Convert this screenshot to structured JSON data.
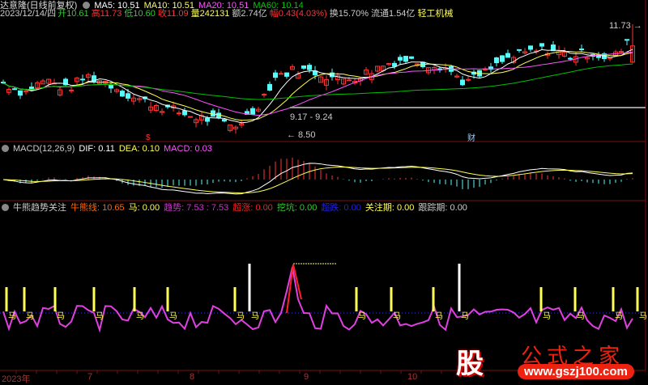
{
  "header": {
    "stock_name": "达意隆(日线前复权)",
    "ma5": "MA5: 10.51",
    "ma10": "MA10: 10.51",
    "ma20": "MA20: 10.51",
    "ma60": "MA60: 10.14",
    "date": "2023/12/14/四",
    "open": "开10.61",
    "high": "高11.73",
    "low": "低10.60",
    "close": "收11.09",
    "volume": "量242131",
    "amount": "额2.74亿",
    "change": "幅0.43(4.03%)",
    "turnover": "换15.70%",
    "float": "流通1.54亿",
    "industry": "轻工机械"
  },
  "main_chart": {
    "high_label": "11.73",
    "low_label": "8.50",
    "range_label": "9.17 - 9.24",
    "marker_s": "$",
    "marker_cai": "财",
    "price_keypoints": [
      10.0,
      9.7,
      10.1,
      9.8,
      10.2,
      10.0,
      9.6,
      9.4,
      9.2,
      9.0,
      8.9,
      8.7,
      9.2,
      10.2,
      10.4,
      10.3,
      10.1,
      10.2,
      10.5,
      10.7,
      10.6,
      10.5,
      10.0,
      10.3,
      10.7,
      10.9,
      11.0,
      10.8,
      10.9,
      10.7,
      11.3
    ]
  },
  "macd": {
    "title": "MACD(12,26,9)",
    "dif": "DIF: 0.11",
    "dea": "DEA: 0.10",
    "macd": "MACD: 0.03"
  },
  "indicator": {
    "title": "牛熊趋势关注",
    "bull_bear": "牛熊线: 10.65",
    "horse": "马: 0.00",
    "trend": "趋势: 7.53 : 7.53",
    "overbought": "超涨: 0.00",
    "dig": "挖坑: 0.00",
    "oversold": "超跌: 0.00",
    "watch": "关注期: 0.00",
    "track": "跟踪期: 0.00",
    "horse_label": "马"
  },
  "axis": {
    "labels": [
      "2023年",
      "7",
      "8",
      "9",
      "10"
    ]
  },
  "watermark": {
    "logo": "股",
    "brand": "公式之家",
    "url": "www.gszj100.com"
  },
  "colors": {
    "up": "#ff3232",
    "down": "#54fcfc",
    "ma5": "#ffffff",
    "ma10": "#ffff54",
    "ma20": "#ff54ff",
    "ma60": "#00c000"
  }
}
